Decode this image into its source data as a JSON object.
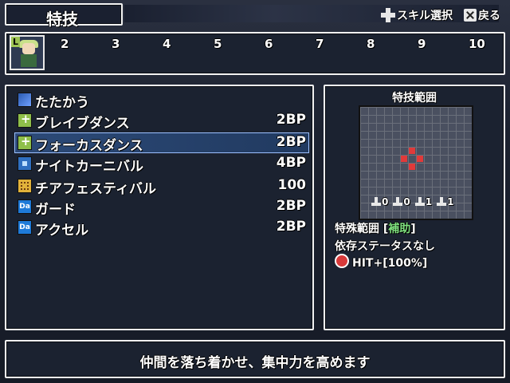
{
  "header": {
    "title": "特技",
    "skill_select_label": "スキル選択",
    "back_label": "戻る"
  },
  "turn_order": {
    "first_badge": "L",
    "slots": [
      "2",
      "3",
      "4",
      "5",
      "6",
      "7",
      "8",
      "9",
      "10"
    ]
  },
  "skills": [
    {
      "name": "たたかう",
      "cost": "",
      "icon": "sword-icon"
    },
    {
      "name": "ブレイブダンス",
      "cost": "2BP",
      "icon": "dance-icon"
    },
    {
      "name": "フォーカスダンス",
      "cost": "2BP",
      "icon": "dance-icon",
      "selected": true
    },
    {
      "name": "ナイトカーニバル",
      "cost": "4BP",
      "icon": "knight-icon"
    },
    {
      "name": "チアフェスティバル",
      "cost": "100",
      "icon": "cheer-icon"
    },
    {
      "name": "ガード",
      "cost": "2BP",
      "icon": "da-icon"
    },
    {
      "name": "アクセル",
      "cost": "2BP",
      "icon": "da-icon"
    }
  ],
  "range_panel": {
    "title": "特技範囲",
    "arrow_values": [
      "0",
      "0",
      "1",
      "1"
    ],
    "special_range_label": "特殊範囲 [",
    "special_range_value": "補助",
    "special_range_close": "]",
    "dependency": "依存ステータスなし",
    "hit": "HIT+[100%]"
  },
  "description": "仲間を落ち着かせ、集中力を高めます",
  "colors": {
    "accent_green": "#7ee07e",
    "range_red": "#e03a3a",
    "cursor_blue": "#2c4a78"
  }
}
